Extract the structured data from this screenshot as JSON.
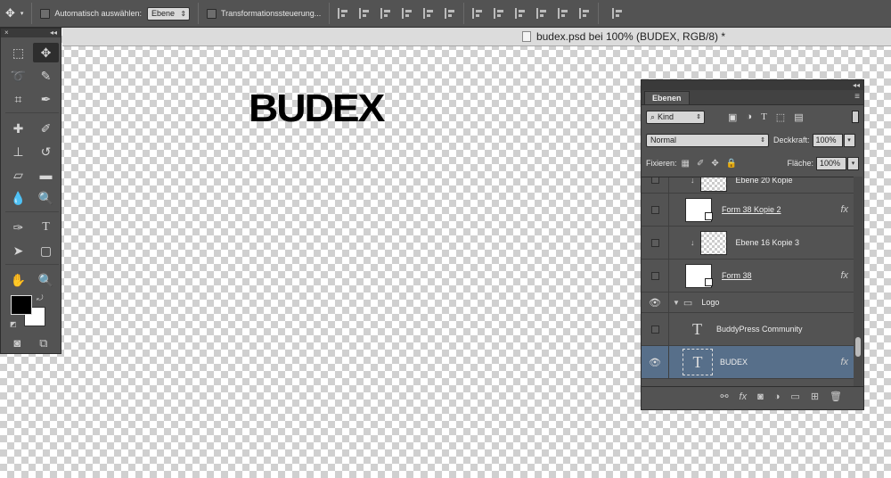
{
  "options_bar": {
    "auto_select_label": "Automatisch auswählen:",
    "auto_select_value": "Ebene",
    "transform_label": "Transformationssteuerung..."
  },
  "document": {
    "title": "budex.psd bei 100% (BUDEX, RGB/8) *"
  },
  "canvas": {
    "text": "BUDEX"
  },
  "layers_panel": {
    "tab": "Ebenen",
    "filter_label": "Kind",
    "blend_mode": "Normal",
    "opacity_label": "Deckkraft:",
    "opacity_value": "100%",
    "lock_label": "Fixieren:",
    "fill_label": "Fläche:",
    "fill_value": "100%",
    "layers": [
      {
        "name": "Ebene 20 Kopie",
        "visible": false
      },
      {
        "name": "Form 38 Kopie 2",
        "visible": false,
        "fx": "fx"
      },
      {
        "name": "Ebene 16 Kopie 3",
        "visible": false
      },
      {
        "name": "Form 38",
        "visible": false,
        "fx": "fx"
      },
      {
        "name": "Logo",
        "visible": true,
        "type": "group"
      },
      {
        "name": "BuddyPress Community",
        "visible": false,
        "type": "text"
      },
      {
        "name": "BUDEX",
        "visible": true,
        "type": "text",
        "selected": true,
        "fx": "fx"
      }
    ]
  }
}
